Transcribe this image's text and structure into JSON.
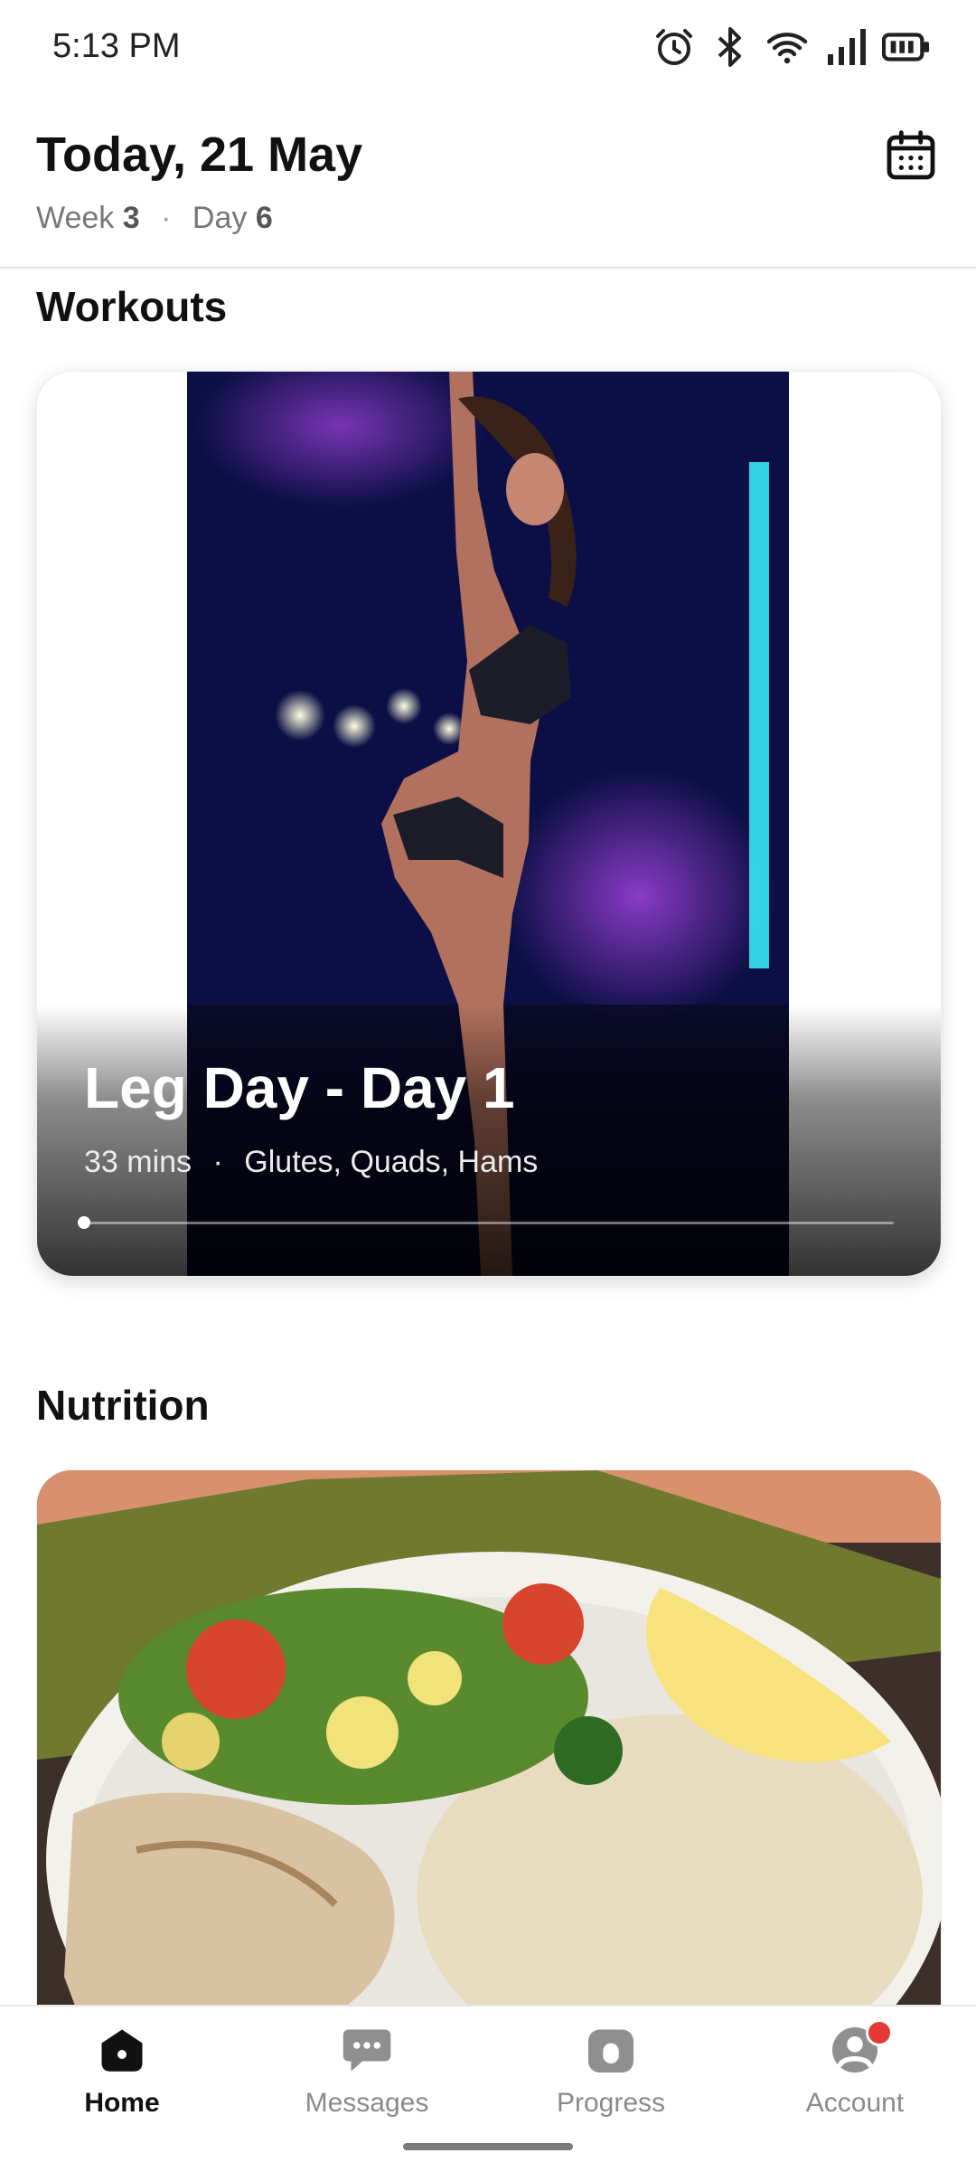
{
  "status_bar": {
    "time": "5:13 PM",
    "icons": [
      "alarm-icon",
      "bluetooth-icon",
      "wifi-icon",
      "signal-icon",
      "battery-icon"
    ]
  },
  "header": {
    "title": "Today, 21 May",
    "week_label": "Week",
    "week_value": "3",
    "separator": "·",
    "day_label": "Day",
    "day_value": "6",
    "calendar_icon": "calendar-icon"
  },
  "workouts": {
    "section_title": "Workouts",
    "card": {
      "title": "Leg Day - Day 1",
      "duration": "33 mins",
      "separator": "·",
      "muscles": "Glutes, Quads, Hams",
      "progress": 0.0
    }
  },
  "nutrition": {
    "section_title": "Nutrition"
  },
  "bottom_nav": {
    "items": [
      {
        "label": "Home",
        "icon": "home-icon",
        "active": true
      },
      {
        "label": "Messages",
        "icon": "chat-icon",
        "active": false
      },
      {
        "label": "Progress",
        "icon": "progress-icon",
        "active": false
      },
      {
        "label": "Account",
        "icon": "account-icon",
        "active": false,
        "badge": true
      }
    ]
  },
  "colors": {
    "badge": "#e53935",
    "active_text": "#111111",
    "inactive_text": "#8a8a8a"
  }
}
